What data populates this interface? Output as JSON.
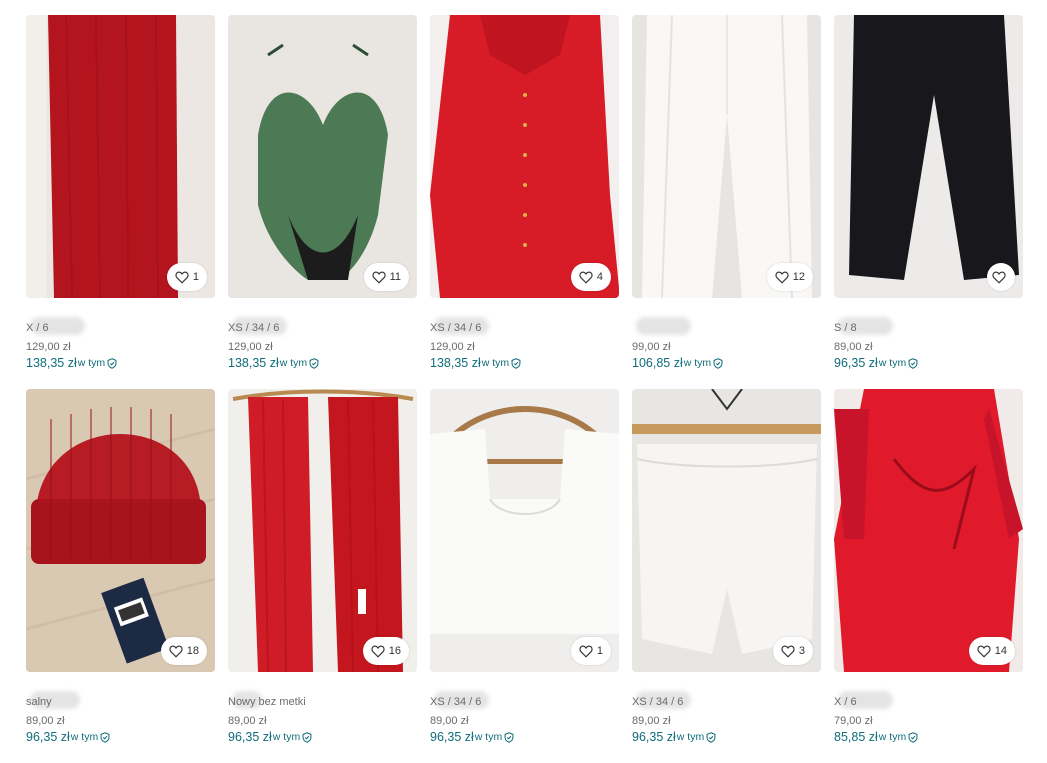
{
  "items": [
    {
      "subtitle": "X / 6",
      "price": "129,00 zł",
      "total": "138,35 zł",
      "incl": "w tym",
      "likes": "1",
      "photo": "red-scarf"
    },
    {
      "subtitle": "XS / 34 / 6",
      "price": "129,00 zł",
      "total": "138,35 zł",
      "incl": "w tym",
      "likes": "11",
      "photo": "green-swimsuit"
    },
    {
      "subtitle": "XS / 34 / 6",
      "price": "129,00 zł",
      "total": "138,35 zł",
      "incl": "w tym",
      "likes": "4",
      "photo": "red-shirt-dress"
    },
    {
      "subtitle": "",
      "price": "99,00 zł",
      "total": "106,85 zł",
      "incl": "w tym",
      "likes": "12",
      "photo": "white-trousers"
    },
    {
      "subtitle": "S / 8",
      "price": "89,00 zł",
      "total": "96,35 zł",
      "incl": "w tym",
      "likes": "",
      "photo": "black-trousers"
    },
    {
      "subtitle": "salny",
      "price": "89,00 zł",
      "total": "96,35 zł",
      "incl": "w tym",
      "likes": "18",
      "photo": "red-beanie"
    },
    {
      "subtitle": "Nowy bez metki",
      "price": "89,00 zł",
      "total": "96,35 zł",
      "incl": "w tym",
      "likes": "16",
      "photo": "red-knit-scarf"
    },
    {
      "subtitle": "XS / 34 / 6",
      "price": "89,00 zł",
      "total": "96,35 zł",
      "incl": "w tym",
      "likes": "1",
      "photo": "white-crop-top"
    },
    {
      "subtitle": "XS / 34 / 6",
      "price": "89,00 zł",
      "total": "96,35 zł",
      "incl": "w tym",
      "likes": "3",
      "photo": "white-shorts"
    },
    {
      "subtitle": "X / 6",
      "price": "79,00 zł",
      "total": "85,85 zł",
      "incl": "w tym",
      "likes": "14",
      "photo": "red-dress"
    }
  ],
  "colors": {
    "accent": "#0f6d7a",
    "muted": "#6b6b6b"
  }
}
